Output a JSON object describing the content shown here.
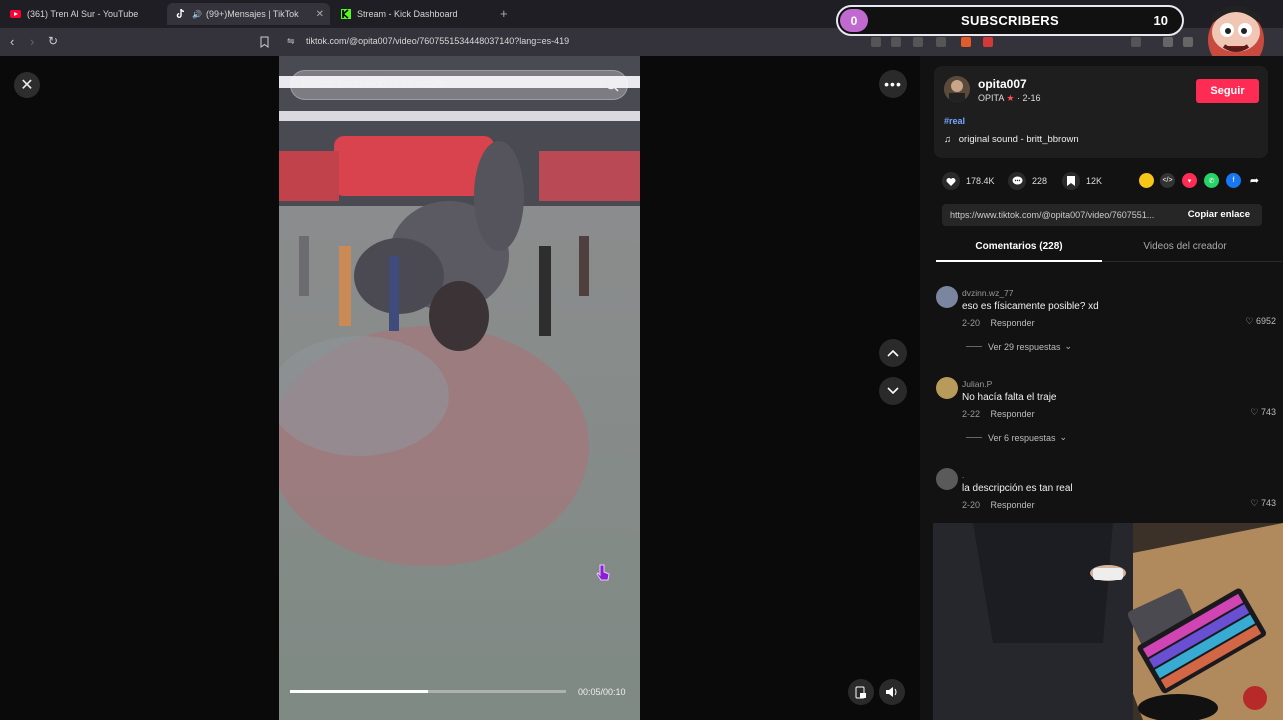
{
  "browser": {
    "tabs": [
      {
        "title": "(361) Tren Al Sur - YouTube",
        "icon": "youtube-icon",
        "active": false
      },
      {
        "title": "(99+)Mensajes | TikTok",
        "icon": "tiktok-icon",
        "active": true
      },
      {
        "title": "Stream - Kick Dashboard",
        "icon": "kick-icon",
        "active": false
      }
    ],
    "url": "tiktok.com/@opita007/video/7607551534448037140?lang=es-419"
  },
  "overlay": {
    "subscribers_count": "0",
    "subscribers_label": "SUBSCRIBERS",
    "subscribers_goal": "10"
  },
  "video": {
    "search_placeholder": "Buscar contenido relacionado",
    "timestamp": "00:05/00:10",
    "progress": 0.5
  },
  "author": {
    "username": "opita007",
    "nickname": "OPITA",
    "date": "· 2-16",
    "follow_label": "Seguir",
    "hashtag": "#real",
    "sound": "original sound - britt_bbrown"
  },
  "stats": {
    "likes": "178.4K",
    "comments": "228",
    "saves": "12K"
  },
  "share": {
    "link": "https://www.tiktok.com/@opita007/video/7607551...",
    "copy_label": "Copiar enlace"
  },
  "panel_tabs": {
    "comments": "Comentarios (228)",
    "videos": "Videos del creador"
  },
  "comments": [
    {
      "user": "dvzinn.wz_77",
      "text": "eso es físicamente posible? xd",
      "date": "2-20",
      "reply": "Responder",
      "likes": "6952",
      "more": "Ver 29 respuestas",
      "avatar_color": "#7a86a0"
    },
    {
      "user": "Julian.P",
      "text": "No hacía falta el traje",
      "date": "2-22",
      "reply": "Responder",
      "likes": "743",
      "more": "Ver 6 respuestas",
      "avatar_color": "#b89a5a"
    },
    {
      "user": ".",
      "text": "la descripción es tan real",
      "date": "2-20",
      "reply": "Responder",
      "likes": "743",
      "more": "",
      "avatar_color": "#5a5a5a"
    }
  ]
}
